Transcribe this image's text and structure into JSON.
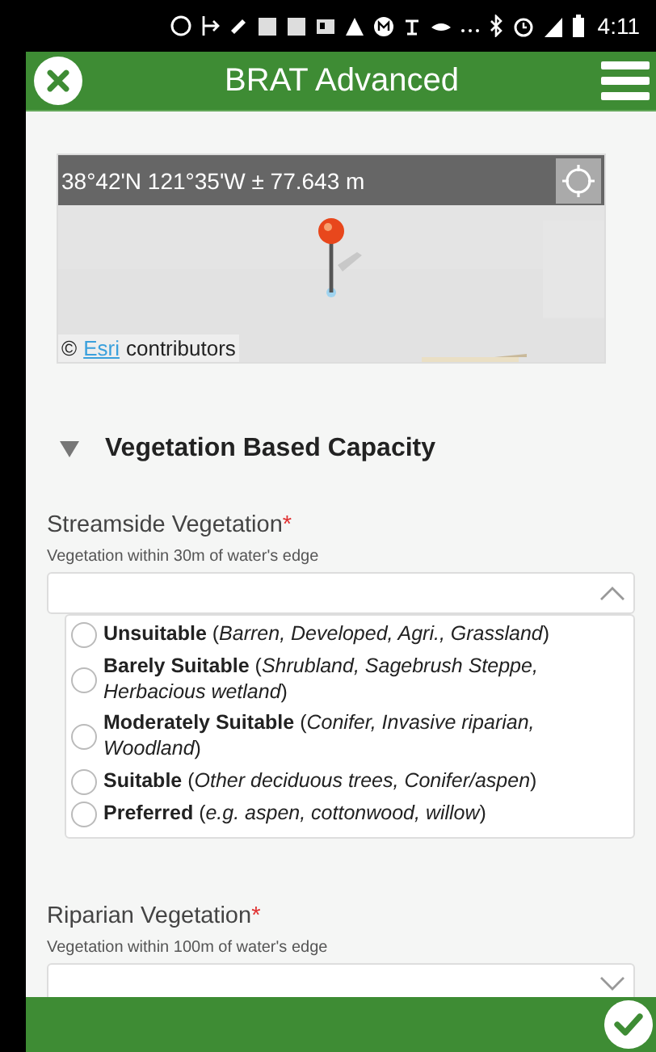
{
  "status_bar": {
    "time": "4:11"
  },
  "header": {
    "title": "BRAT Advanced"
  },
  "map": {
    "coordinates": "38°42'N 121°35'W ± 77.643 m",
    "attribution_prefix": "©",
    "attribution_link": "Esri",
    "attribution_suffix": "contributors"
  },
  "section": {
    "title": "Vegetation Based Capacity",
    "expanded": true
  },
  "fields": [
    {
      "label": "Streamside Vegetation",
      "required_mark": "*",
      "hint": "Vegetation within 30m of water's edge",
      "expanded": true,
      "options": [
        {
          "text": "**Unsuitable** (*Barren, Developed, Agri., Grassland*)",
          "selected": false
        },
        {
          "text": "**Barely Suitable** (*Shrubland, Sagebrush Steppe, Herbacious wetland*)",
          "selected": false
        },
        {
          "text": "**Moderately Suitable** (*Conifer, Invasive riparian, Woodland*)",
          "selected": false
        },
        {
          "text": "**Suitable** (*Other deciduous trees, Conifer/aspen*)",
          "selected": false
        },
        {
          "text": "**Preferred** (*e.g. aspen, cottonwood, willow*)",
          "selected": false
        }
      ]
    },
    {
      "label": "Riparian Vegetation",
      "required_mark": "*",
      "hint": "Vegetation within 100m of water's edge",
      "expanded": false
    }
  ]
}
